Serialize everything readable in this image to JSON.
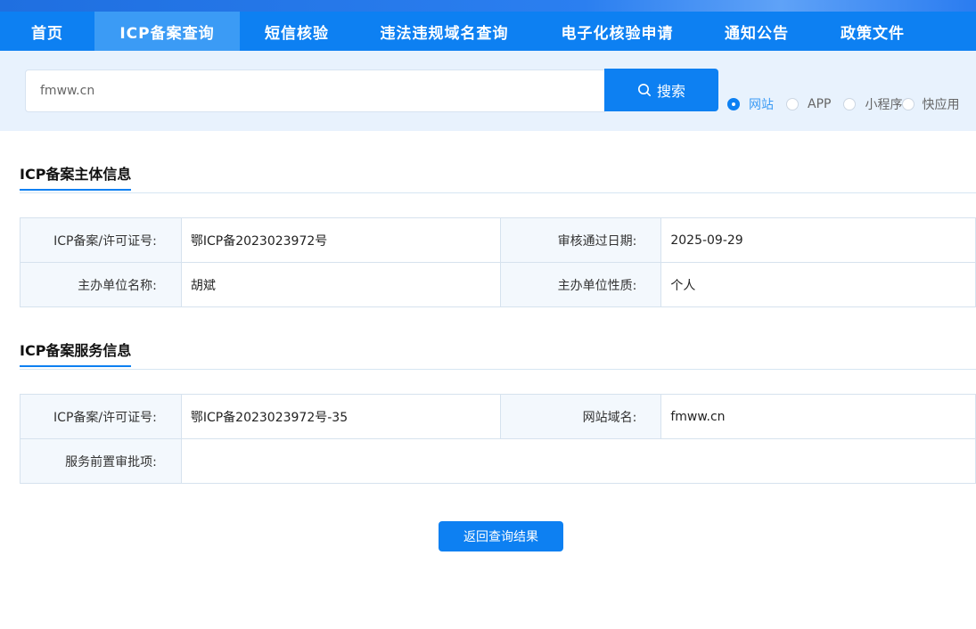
{
  "nav": {
    "items": [
      {
        "label": "首页"
      },
      {
        "label": "ICP备案查询"
      },
      {
        "label": "短信核验"
      },
      {
        "label": "违法违规域名查询"
      },
      {
        "label": "电子化核验申请"
      },
      {
        "label": "通知公告"
      },
      {
        "label": "政策文件"
      }
    ],
    "active": "ICP备案查询"
  },
  "search": {
    "value": "fmww.cn",
    "button_label": "搜索",
    "types": [
      {
        "label": "网站",
        "checked": true
      },
      {
        "label": "APP",
        "checked": false
      },
      {
        "label": "小程序",
        "checked": false
      },
      {
        "label": "快应用",
        "checked": false
      }
    ]
  },
  "subject_section": {
    "title": "ICP备案主体信息",
    "rows": [
      {
        "label1": "ICP备案/许可证号:",
        "value1": "鄂ICP备2023023972号",
        "label2": "审核通过日期:",
        "value2": "2025-09-29"
      },
      {
        "label1": "主办单位名称:",
        "value1": "胡斌",
        "label2": "主办单位性质:",
        "value2": "个人"
      }
    ]
  },
  "service_section": {
    "title": "ICP备案服务信息",
    "rows": [
      {
        "label1": "ICP备案/许可证号:",
        "value1": "鄂ICP备2023023972号-35",
        "label2": "网站域名:",
        "value2": "fmww.cn"
      },
      {
        "label1": "服务前置审批项:",
        "value1": ""
      }
    ]
  },
  "back_button": {
    "label": "返回查询结果"
  },
  "colors": {
    "primary": "#0d80f2",
    "nav_active": "#3b9bf5",
    "search_bg": "#e8f2fd"
  }
}
